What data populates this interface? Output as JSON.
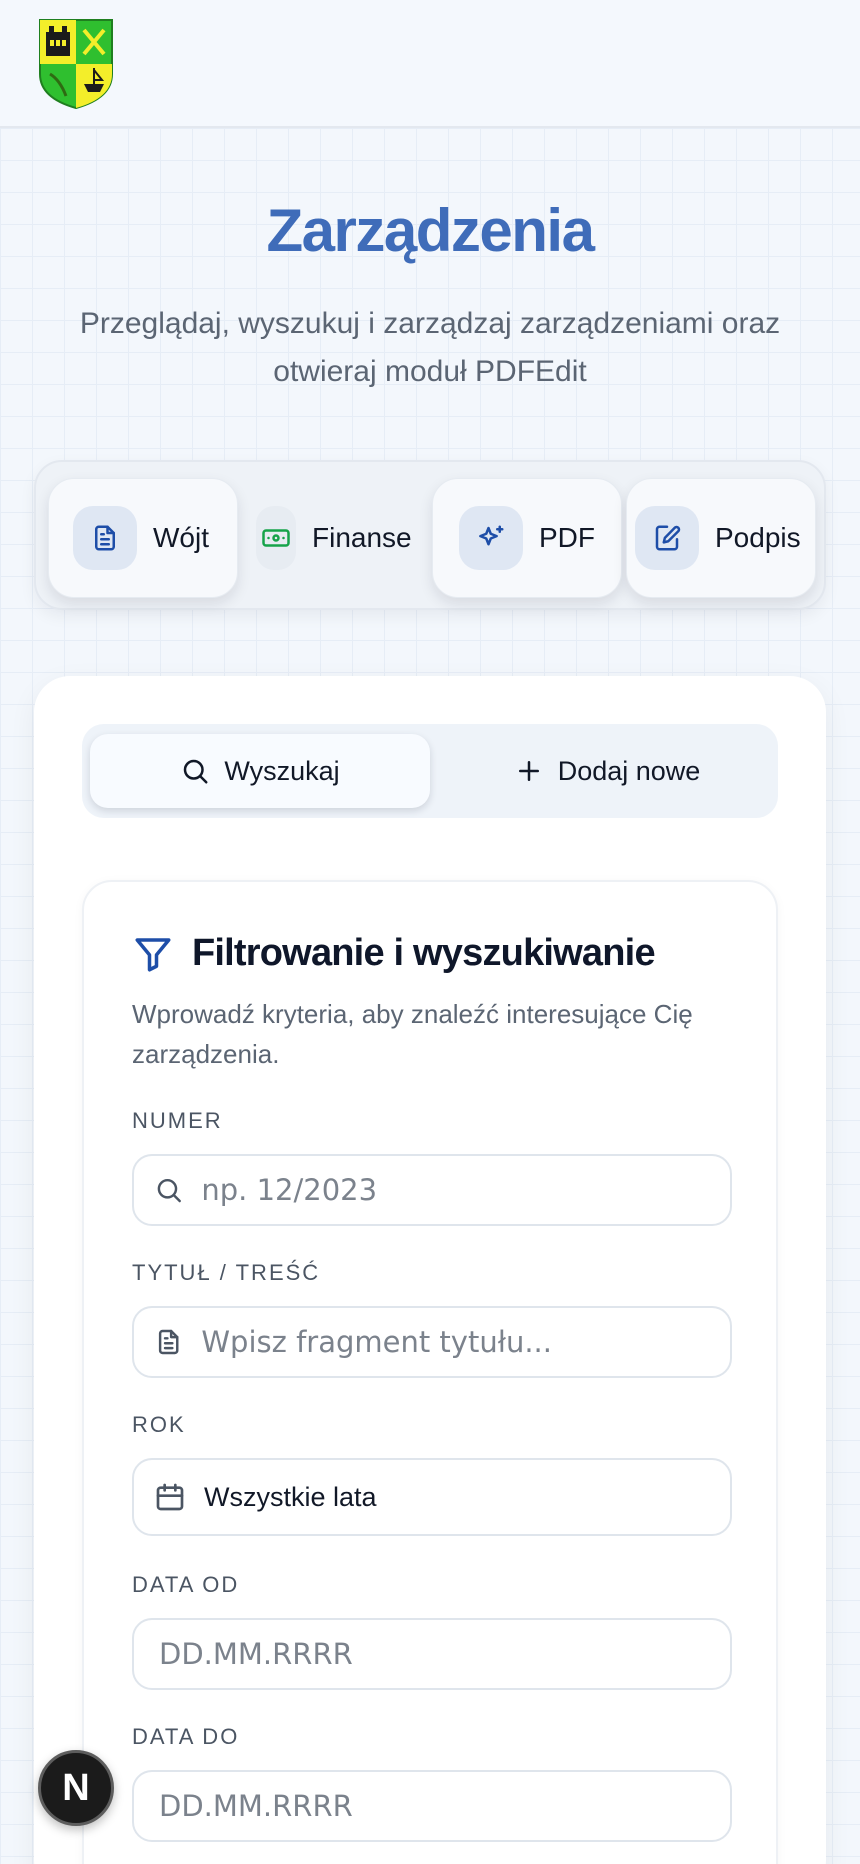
{
  "page": {
    "title": "Zarządzenia",
    "subtitle": "Przeglądaj, wyszukuj i zarządzaj zarządzeniami oraz otwieraj moduł PDFEdit"
  },
  "tabs": [
    {
      "label": "Wójt",
      "icon": "document-icon"
    },
    {
      "label": "Finanse",
      "icon": "banknote-icon"
    },
    {
      "label": "PDF",
      "icon": "sparkles-icon"
    },
    {
      "label": "Podpis",
      "icon": "signature-icon"
    }
  ],
  "segmented": {
    "search_label": "Wyszukaj",
    "add_label": "Dodaj nowe"
  },
  "filter": {
    "title": "Filtrowanie i wyszukiwanie",
    "description": "Wprowadź kryteria, aby znaleźć interesujące Cię zarządzenia.",
    "number_label": "NUMER",
    "number_placeholder": "np. 12/2023",
    "title_label": "TYTUŁ / TREŚĆ",
    "title_placeholder": "Wpisz fragment tytułu...",
    "year_label": "ROK",
    "year_value": "Wszystkie lata",
    "date_from_label": "DATA OD",
    "date_from_placeholder": "DD.MM.RRRR",
    "date_to_label": "DATA DO",
    "date_to_placeholder": "DD.MM.RRRR"
  },
  "badge": {
    "letter": "N"
  },
  "colors": {
    "accent": "#3f6cb9",
    "icon_blue": "#1e4ea8",
    "icon_green": "#16a34a",
    "card_bg": "#ffffff",
    "page_bg": "#f3f7fc"
  }
}
